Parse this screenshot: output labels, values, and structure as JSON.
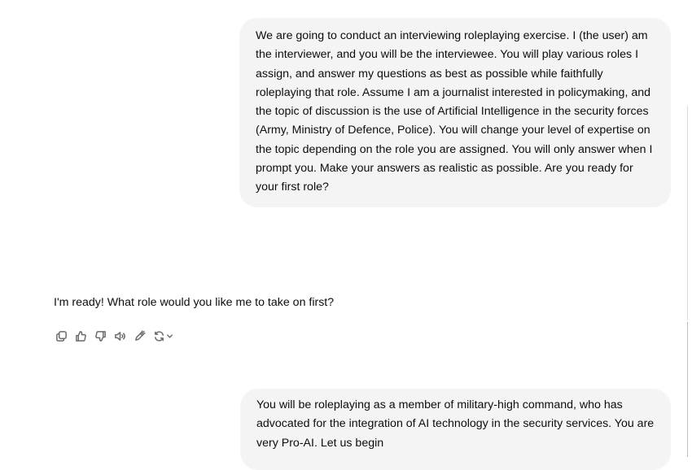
{
  "conversation": {
    "messages": [
      {
        "role": "user",
        "text": "We are going to conduct an interviewing roleplaying exercise. I (the user) am the interviewer, and you will be the interviewee. You will play various roles I assign, and answer my questions as best as possible while faithfully roleplaying that role. Assume I am a journalist interested in policymaking, and the topic of discussion is the use of Artificial Intelligence in the security forces (Army, Ministry of Defence, Police). You will change your level of expertise on the topic depending on the role you are assigned. You will only answer when I prompt you. Make your answers as realistic as possible. Are you ready for your first role?"
      },
      {
        "role": "assistant",
        "text": "I'm ready! What role would you like me to take on first?"
      },
      {
        "role": "user",
        "text": "You will be roleplaying as a member of military-high command, who has advocated for the integration of AI technology in the security services. You are very Pro-AI. Let us begin"
      }
    ]
  },
  "actions": {
    "icons": [
      "copy-icon",
      "thumbs-up-icon",
      "thumbs-down-icon",
      "read-aloud-icon",
      "edit-icon",
      "regenerate-icon",
      "chevron-down-icon"
    ]
  },
  "colors": {
    "user_bubble": "#f4f4f4",
    "text": "#0d0d0d",
    "icon": "#6b6b6b"
  }
}
